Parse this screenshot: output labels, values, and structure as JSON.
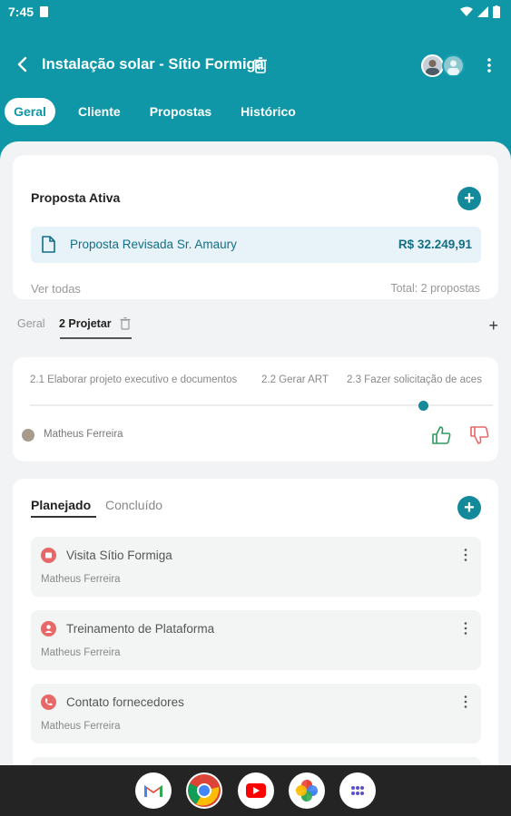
{
  "status": {
    "time": "7:45"
  },
  "header": {
    "title": "Instalação solar - Sítio Formiga"
  },
  "tabs": [
    {
      "label": "Geral",
      "active": true
    },
    {
      "label": "Cliente",
      "active": false
    },
    {
      "label": "Propostas",
      "active": false
    },
    {
      "label": "Histórico",
      "active": false
    }
  ],
  "proposal_card": {
    "title": "Proposta Ativa",
    "proposal_name": "Proposta Revisada Sr. Amaury",
    "proposal_value": "R$ 32.249,91",
    "see_all": "Ver todas",
    "total": "Total: 2 propostas"
  },
  "stage_tabs": [
    {
      "label": "Geral",
      "active": false
    },
    {
      "label": "2 Projetar",
      "active": true
    }
  ],
  "steps": {
    "items": [
      "2.1 Elaborar projeto executivo e documentos",
      "2.2 Gerar ART",
      "2.3 Fazer solicitação de aces"
    ],
    "assignee": "Matheus Ferreira"
  },
  "tasks_card": {
    "tab_planned": "Planejado",
    "tab_done": "Concluído",
    "tasks": [
      {
        "title": "Visita Sítio Formiga",
        "user": "Matheus Ferreira",
        "icon": "calendar-icon"
      },
      {
        "title": "Treinamento de Plataforma",
        "user": "Matheus Ferreira",
        "icon": "people-icon"
      },
      {
        "title": "Contato fornecedores",
        "user": "Matheus Ferreira",
        "icon": "phone-icon"
      },
      {
        "title": "",
        "user": "",
        "icon": ""
      }
    ]
  },
  "colors": {
    "primary": "#0f97a8",
    "accent_dark": "#13899a",
    "danger": "#e86868"
  }
}
